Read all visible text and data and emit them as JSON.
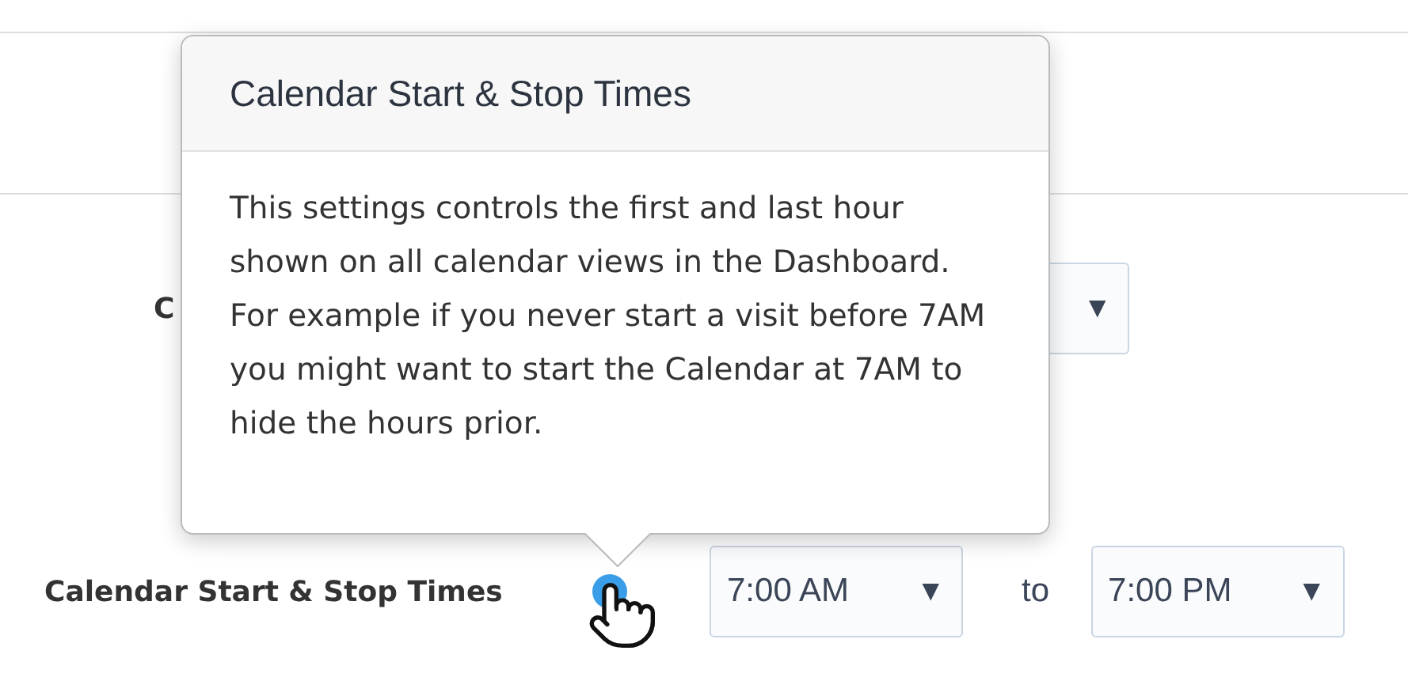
{
  "rows": [
    {
      "label": "C",
      "selects": [
        {
          "caret": "▼"
        }
      ]
    },
    {
      "label": "Calendar Start & Stop Times",
      "selects": [
        {
          "value": "7:00 AM",
          "caret": "▼"
        },
        {
          "value": "7:00 PM",
          "caret": "▼"
        }
      ],
      "separator": "to"
    }
  ],
  "popover": {
    "title": "Calendar Start & Stop Times",
    "body": "This settings controls the first and last hour shown on all calendar views in the Dashboard. For example if you never start a visit before 7AM you might want to start the Calendar at 7AM to hide the hours prior."
  }
}
